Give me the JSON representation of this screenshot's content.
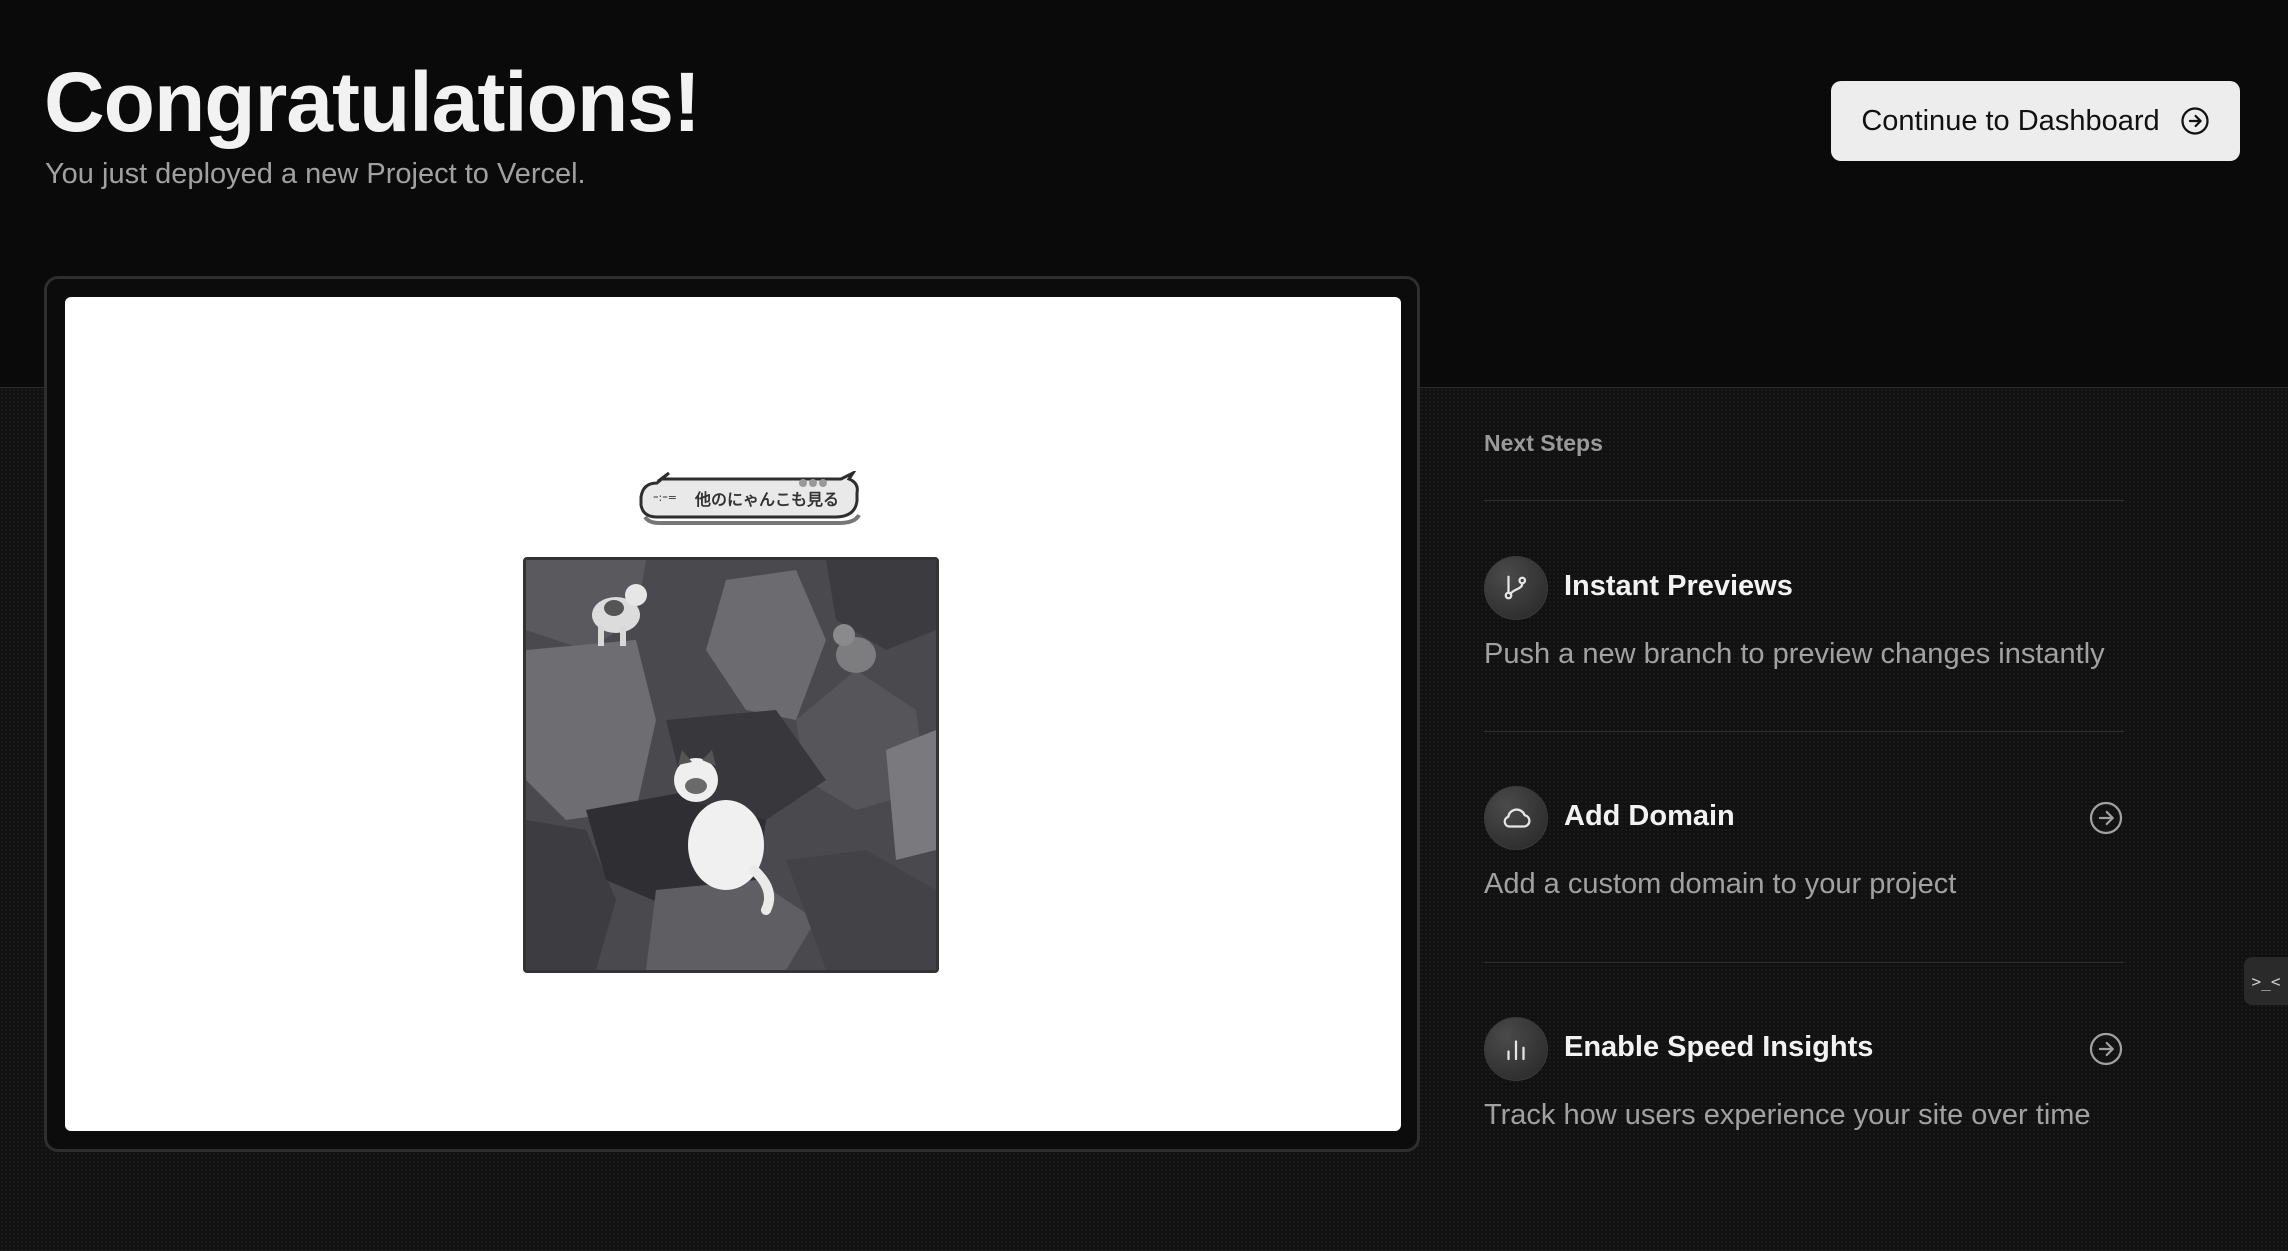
{
  "header": {
    "title": "Congratulations!",
    "subtitle": "You just deployed a new Project to Vercel.",
    "dashboard_button_label": "Continue to Dashboard"
  },
  "preview": {
    "bubble_text": "他のにゃんこも見る"
  },
  "next_steps": {
    "heading": "Next Steps",
    "items": [
      {
        "icon": "git-branch-icon",
        "title": "Instant Previews",
        "description": "Push a new branch to preview changes instantly",
        "has_arrow": false
      },
      {
        "icon": "cloud-icon",
        "title": "Add Domain",
        "description": "Add a custom domain to your project",
        "has_arrow": true
      },
      {
        "icon": "bar-chart-icon",
        "title": "Enable Speed Insights",
        "description": "Track how users experience your site over time",
        "has_arrow": true
      }
    ]
  },
  "side_tab": {
    "label": ">_<"
  },
  "colors": {
    "background": "#0a0a0a",
    "panel": "#111111",
    "button_bg": "#ededed",
    "muted_text": "#a1a1a1"
  }
}
